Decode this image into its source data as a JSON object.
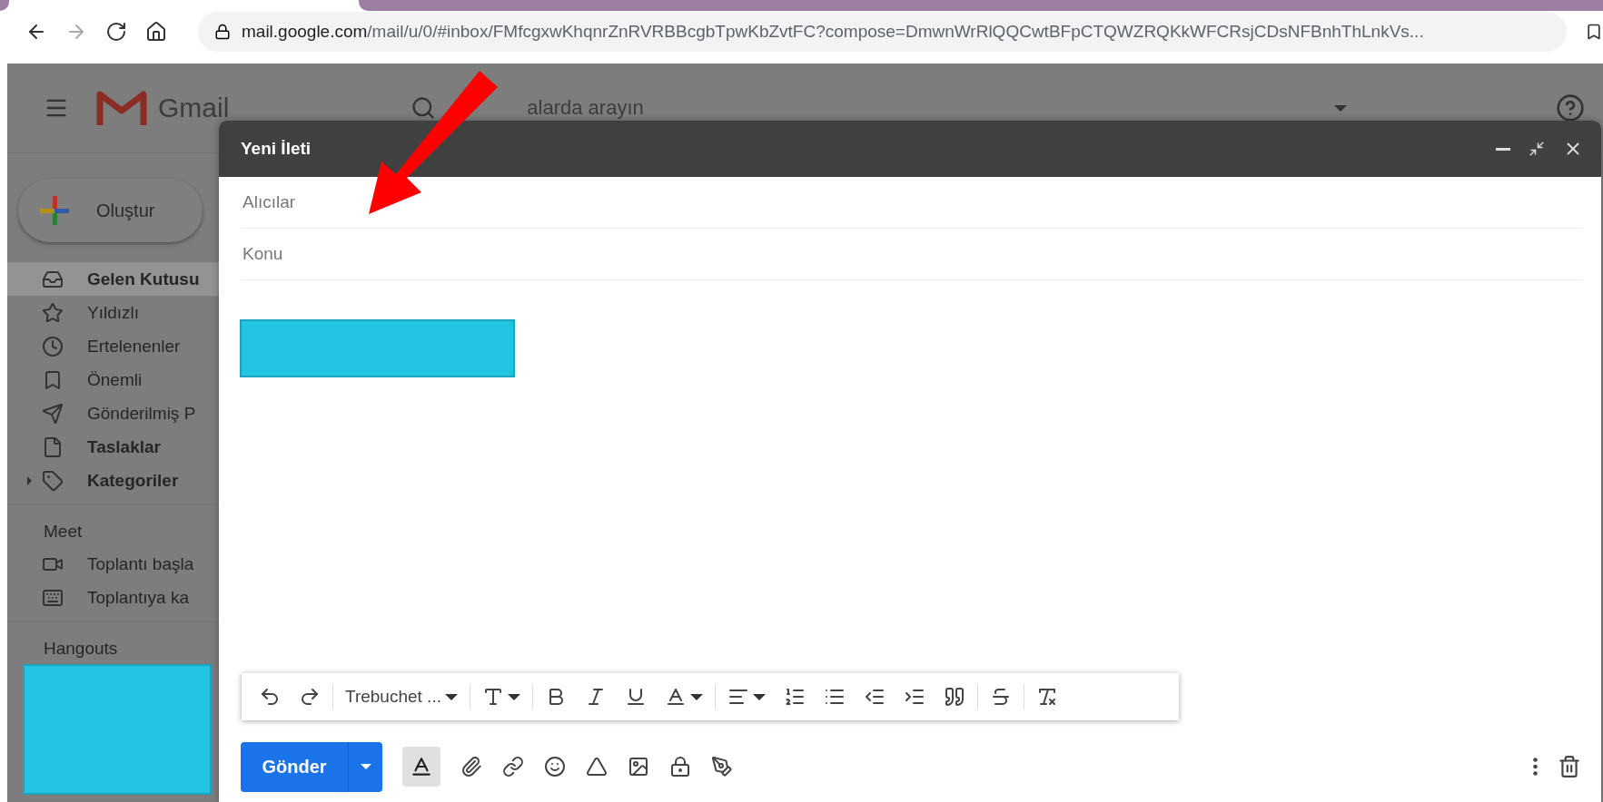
{
  "browser": {
    "url_host": "mail.google.com",
    "url_path": "/mail/u/0/#inbox/FMfcgxwKhqnrZnRVRBBcgbTpwKbZvtFC?compose=DmwnWrRlQQCwtBFpCTQWZRQKkWFCRsjCDsNFBnhThLnkVs..."
  },
  "header": {
    "logo_text": "Gmail",
    "search": {
      "placeholder": "alarda arayın"
    }
  },
  "compose_button": {
    "label": "Oluştur"
  },
  "sidebar": {
    "items": [
      {
        "label": "Gelen Kutusu",
        "bold": true,
        "selected": true
      },
      {
        "label": "Yıldızlı",
        "bold": false,
        "selected": false
      },
      {
        "label": "Ertelenenler",
        "bold": false,
        "selected": false
      },
      {
        "label": "Önemli",
        "bold": false,
        "selected": false
      },
      {
        "label": "Gönderilmiş P",
        "bold": false,
        "selected": false
      },
      {
        "label": "Taslaklar",
        "bold": true,
        "selected": false
      },
      {
        "label": "Kategoriler",
        "bold": true,
        "selected": false,
        "expanded": false
      }
    ],
    "sections": [
      {
        "title": "Meet",
        "items": [
          {
            "label": "Toplantı başla"
          },
          {
            "label": "Toplantıya ka"
          }
        ]
      },
      {
        "title": "Hangouts"
      }
    ]
  },
  "compose": {
    "title": "Yeni İleti",
    "fields": [
      {
        "placeholder": "Alıcılar"
      },
      {
        "placeholder": "Konu"
      }
    ],
    "format_toolbar": {
      "font": "Trebuchet ..."
    },
    "send_button": {
      "label": "Gönder"
    },
    "formatting_toggle": {
      "on": true
    }
  }
}
